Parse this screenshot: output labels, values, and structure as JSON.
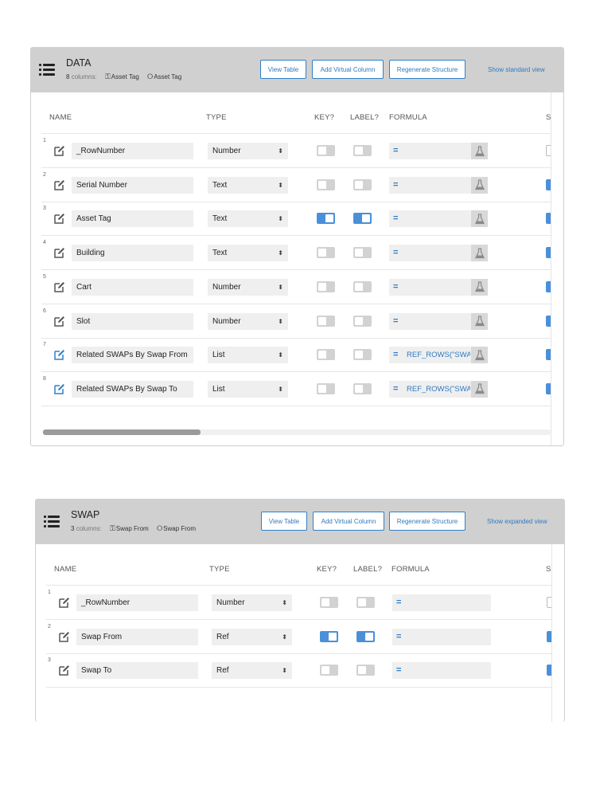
{
  "tables": [
    {
      "name": "DATA",
      "column_count": "8",
      "columns_label": "columns:",
      "key_tag": "Asset Tag",
      "label_tag": "Asset Tag",
      "buttons": {
        "view_table": "View Table",
        "add_virtual": "Add Virtual Column",
        "regenerate": "Regenerate Structure",
        "toggle_view": "Show standard view"
      },
      "headers": {
        "name": "NAME",
        "type": "TYPE",
        "key": "KEY?",
        "label": "LABEL?",
        "formula": "FORMULA",
        "cut": "S"
      },
      "rows": [
        {
          "num": "1",
          "name": "_RowNumber",
          "type": "Number",
          "key": false,
          "label": false,
          "formula": "",
          "virtual": false,
          "show": false
        },
        {
          "num": "2",
          "name": "Serial Number",
          "type": "Text",
          "key": false,
          "label": false,
          "formula": "",
          "virtual": false,
          "show": true
        },
        {
          "num": "3",
          "name": "Asset Tag",
          "type": "Text",
          "key": true,
          "label": true,
          "formula": "",
          "virtual": false,
          "show": true
        },
        {
          "num": "4",
          "name": "Building",
          "type": "Text",
          "key": false,
          "label": false,
          "formula": "",
          "virtual": false,
          "show": true
        },
        {
          "num": "5",
          "name": "Cart",
          "type": "Number",
          "key": false,
          "label": false,
          "formula": "",
          "virtual": false,
          "show": true
        },
        {
          "num": "6",
          "name": "Slot",
          "type": "Number",
          "key": false,
          "label": false,
          "formula": "",
          "virtual": false,
          "show": true
        },
        {
          "num": "7",
          "name": "Related SWAPs By Swap From",
          "type": "List",
          "key": false,
          "label": false,
          "formula": "REF_ROWS(\"SWAF",
          "virtual": true,
          "show": true
        },
        {
          "num": "8",
          "name": "Related SWAPs By Swap To",
          "type": "List",
          "key": false,
          "label": false,
          "formula": "REF_ROWS(\"SWAF",
          "virtual": true,
          "show": true
        }
      ],
      "scroll_position": 0.31
    },
    {
      "name": "SWAP",
      "column_count": "3",
      "columns_label": "columns:",
      "key_tag": "Swap From",
      "label_tag": "Swap From",
      "buttons": {
        "view_table": "View Table",
        "add_virtual": "Add Virtual Column",
        "regenerate": "Regenerate Structure",
        "toggle_view": "Show expanded view"
      },
      "headers": {
        "name": "NAME",
        "type": "TYPE",
        "key": "KEY?",
        "label": "LABEL?",
        "formula": "FORMULA",
        "cut": "SI"
      },
      "rows": [
        {
          "num": "1",
          "name": "_RowNumber",
          "type": "Number",
          "key": false,
          "label": false,
          "formula": "",
          "virtual": false,
          "show": false
        },
        {
          "num": "2",
          "name": "Swap From",
          "type": "Ref",
          "key": true,
          "label": true,
          "formula": "",
          "virtual": false,
          "show": true
        },
        {
          "num": "3",
          "name": "Swap To",
          "type": "Ref",
          "key": false,
          "label": false,
          "formula": "",
          "virtual": false,
          "show": true
        }
      ]
    }
  ],
  "colors": {
    "accent": "#2f80c7",
    "header_bg": "#d0d0d0",
    "toggle_on": "#4a90d9",
    "toggle_off": "#d2d2d2"
  },
  "icons": {
    "menu": "list-menu-icon",
    "edit": "edit-pencil-icon",
    "key": "key-icon",
    "label": "tag-icon",
    "flask": "flask-icon",
    "select": "updown-arrows-icon"
  }
}
